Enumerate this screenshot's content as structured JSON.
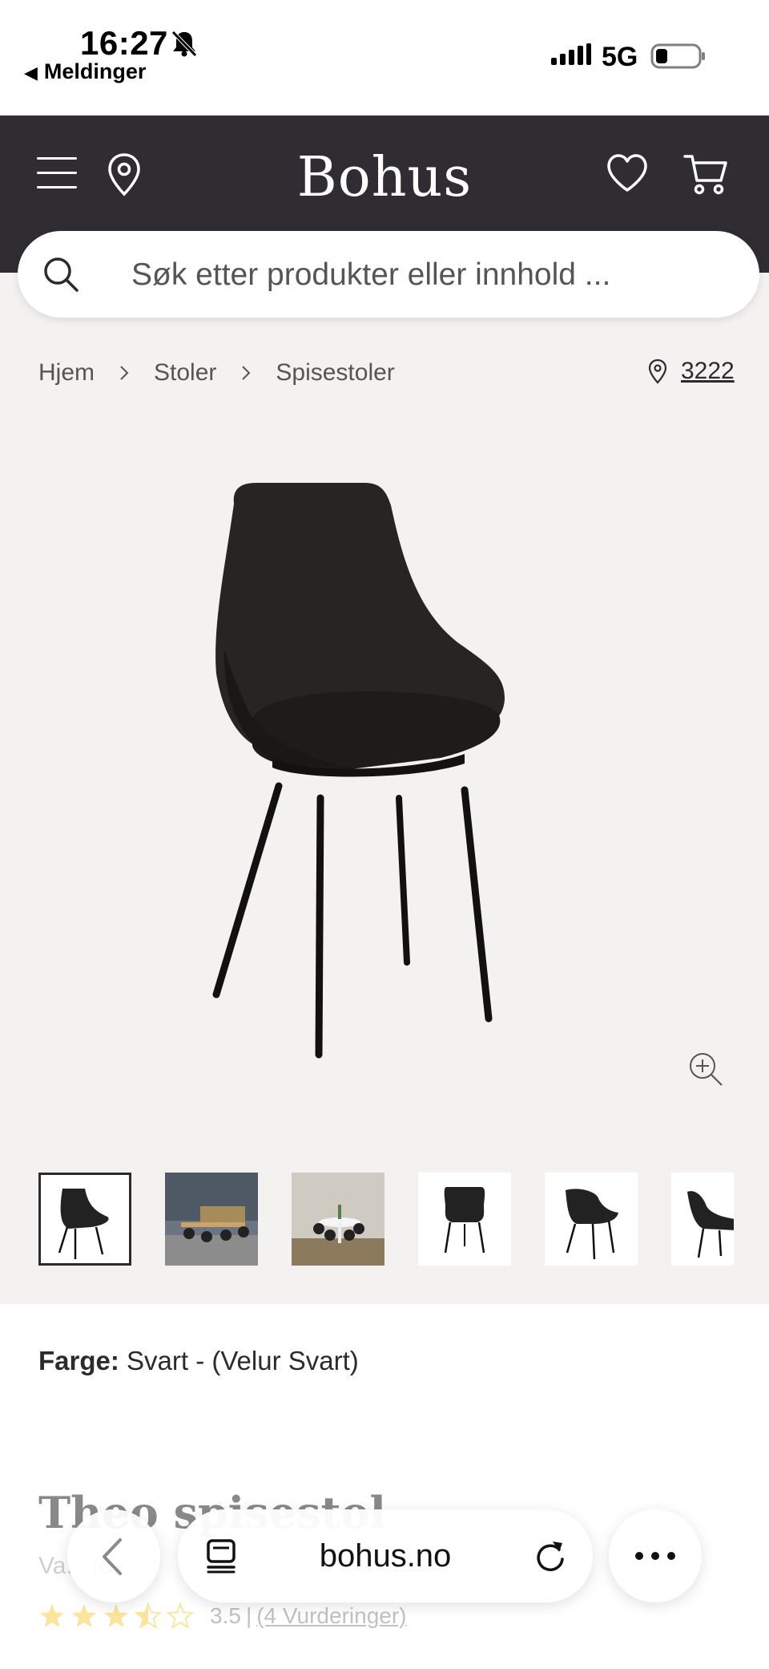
{
  "status_bar": {
    "time": "16:27",
    "back_app": "Meldinger",
    "network": "5G"
  },
  "header": {
    "logo": "Bohus",
    "icons": [
      "menu-icon",
      "location-pin-icon",
      "heart-icon",
      "cart-icon"
    ]
  },
  "search": {
    "placeholder": "Søk etter produkter eller innhold ..."
  },
  "breadcrumb": {
    "items": [
      "Hjem",
      "Stoler",
      "Spisestoler"
    ],
    "store_number": "3222"
  },
  "gallery": {
    "thumbnail_count": 6,
    "active_index": 0
  },
  "product": {
    "color_label": "Farge:",
    "color_value": "Svart - (Velur Svart)",
    "title": "Theo spisestol",
    "subtitle": "Va... le...",
    "rating_value": "3.5",
    "rating_separator": "|",
    "rating_count": "(4 Vurderinger)",
    "stars": 3.5
  },
  "browser": {
    "url": "bohus.no"
  },
  "colors": {
    "header_bg": "#2f2d32",
    "page_bg": "#f4f2f0",
    "star": "#f3c623"
  }
}
